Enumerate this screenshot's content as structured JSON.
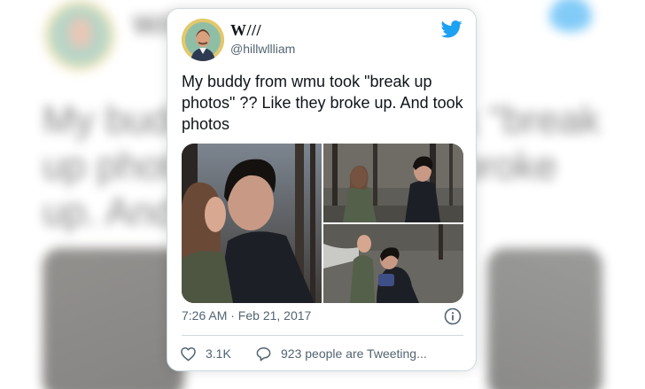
{
  "tweet": {
    "display_name": "W///",
    "handle": "@hillwllliam",
    "text": "My buddy from wmu took \"break up photos\" ?? Like they broke up. And took photos",
    "timestamp": "7:26 AM · Feb 21, 2017",
    "likes": "3.1K",
    "conversation_label": "923 people are Tweeting...",
    "media_count": 3
  },
  "colors": {
    "twitter_blue": "#1da1f2",
    "text_primary": "#0f1419",
    "text_secondary": "#536471",
    "border": "#cfd9de",
    "avatar_bg": "#e3c86d"
  },
  "icons": {
    "brand": "twitter-bird-icon",
    "info": "info-icon",
    "like": "heart-icon",
    "reply": "speech-bubble-icon"
  }
}
